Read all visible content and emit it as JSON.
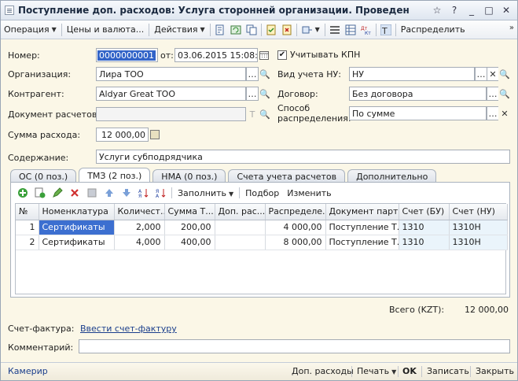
{
  "window": {
    "title": "Поступление доп. расходов: Услуга сторонней организации. Проведен"
  },
  "toolbar": {
    "operation": "Операция",
    "prices": "Цены и валюта...",
    "actions": "Действия",
    "distribute": "Распределить"
  },
  "form": {
    "number_label": "Номер:",
    "number_value": "0000000001",
    "date_label": "от:",
    "date_value": "03.06.2015 15:08:12",
    "kpn_label": "Учитывать КПН",
    "kpn_checked": true,
    "org_label": "Организация:",
    "org_value": "Лира ТОО",
    "tax_label": "Вид учета НУ:",
    "tax_value": "НУ",
    "contractor_label": "Контрагент:",
    "contractor_value": "Aldyar Great ТОО",
    "contract_label": "Договор:",
    "contract_value": "Без договора",
    "settlement_label": "Документ расчетов:",
    "settlement_value": "",
    "method_label_1": "Способ",
    "method_label_2": "распределения:",
    "method_value": "По сумме",
    "amount_label": "Сумма расхода:",
    "amount_value": "12 000,00",
    "content_label": "Содержание:",
    "content_value": "Услуги субподрядчика"
  },
  "tabs": [
    {
      "label": "ОС (0 поз.)",
      "active": false
    },
    {
      "label": "ТМЗ (2 поз.)",
      "active": true
    },
    {
      "label": "НМА (0 поз.)",
      "active": false
    },
    {
      "label": "Счета учета расчетов",
      "active": false
    },
    {
      "label": "Дополнительно",
      "active": false
    }
  ],
  "inner_toolbar": {
    "fill": "Заполнить",
    "select": "Подбор",
    "change": "Изменить"
  },
  "table": {
    "columns": [
      "№",
      "Номенклатура",
      "Количест...",
      "Сумма Т...",
      "Доп. рас...",
      "Распределе...",
      "Документ парт...",
      "Счет (БУ)",
      "Счет (НУ)"
    ],
    "rows": [
      [
        "1",
        "Сертификаты",
        "2,000",
        "200,00",
        "",
        "4 000,00",
        "Поступление Т...",
        "1310",
        "1310Н"
      ],
      [
        "2",
        "Сертификаты",
        "4,000",
        "400,00",
        "",
        "8 000,00",
        "Поступление Т...",
        "1310",
        "1310Н"
      ]
    ]
  },
  "totals": {
    "label": "Всего (KZT):",
    "value": "12 000,00"
  },
  "invoice": {
    "label": "Счет-фактура:",
    "link": "Ввести счет-фактуру"
  },
  "comment": {
    "label": "Комментарий:",
    "value": ""
  },
  "footer": {
    "user": "Камерир",
    "extra_costs": "Доп. расходы",
    "print": "Печать",
    "ok": "OK",
    "save": "Записать",
    "close": "Закрыть"
  },
  "colors": {
    "window_bg": "#fbf7e7",
    "selection": "#3c6fd0"
  }
}
